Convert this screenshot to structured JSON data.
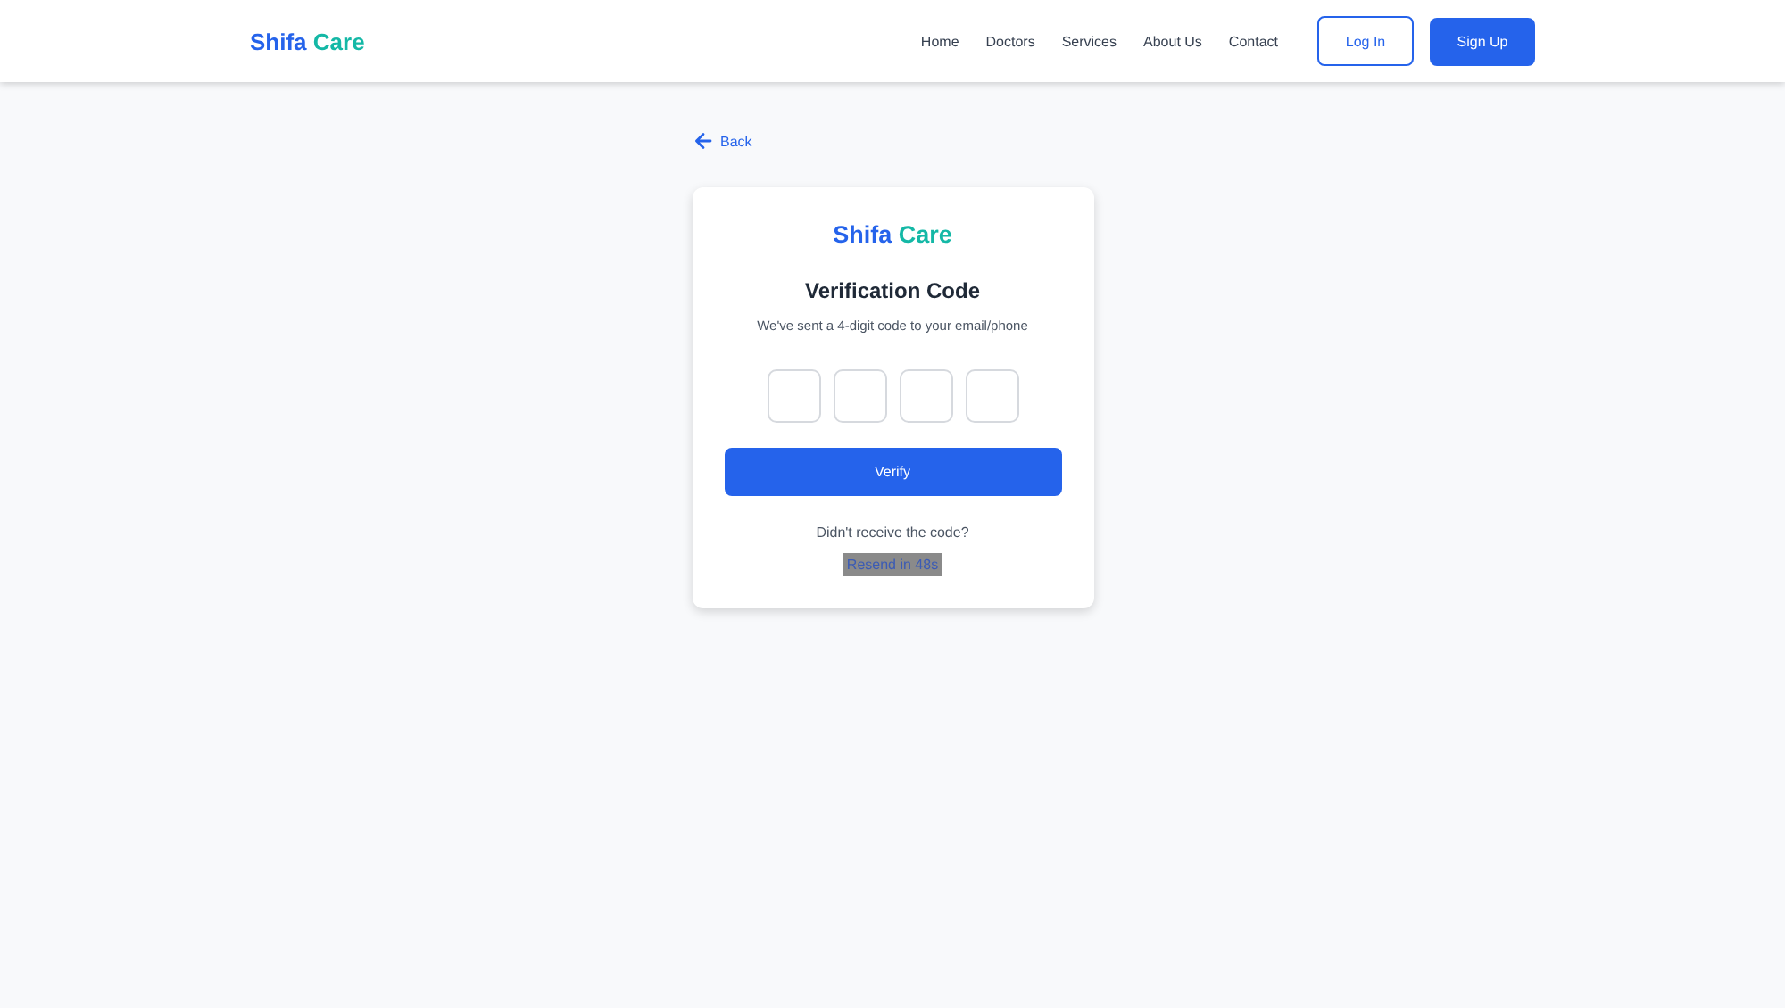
{
  "header": {
    "logo": {
      "first": "Shifa",
      "second": "Care"
    },
    "nav": [
      {
        "label": "Home"
      },
      {
        "label": "Doctors"
      },
      {
        "label": "Services"
      },
      {
        "label": "About Us"
      },
      {
        "label": "Contact"
      }
    ],
    "login": "Log In",
    "signup": "Sign Up"
  },
  "back": "Back",
  "card": {
    "logo": {
      "first": "Shifa",
      "second": "Care"
    },
    "title": "Verification Code",
    "subtitle": "We've sent a 4-digit code to your email/phone",
    "code_inputs": [
      {
        "focused": false
      },
      {
        "focused": false
      },
      {
        "focused": false
      },
      {
        "focused": false
      }
    ],
    "verify": "Verify",
    "resend_prompt": "Didn't receive the code?",
    "resend": {
      "label": "Resend in 48s",
      "disabled": true
    }
  }
}
